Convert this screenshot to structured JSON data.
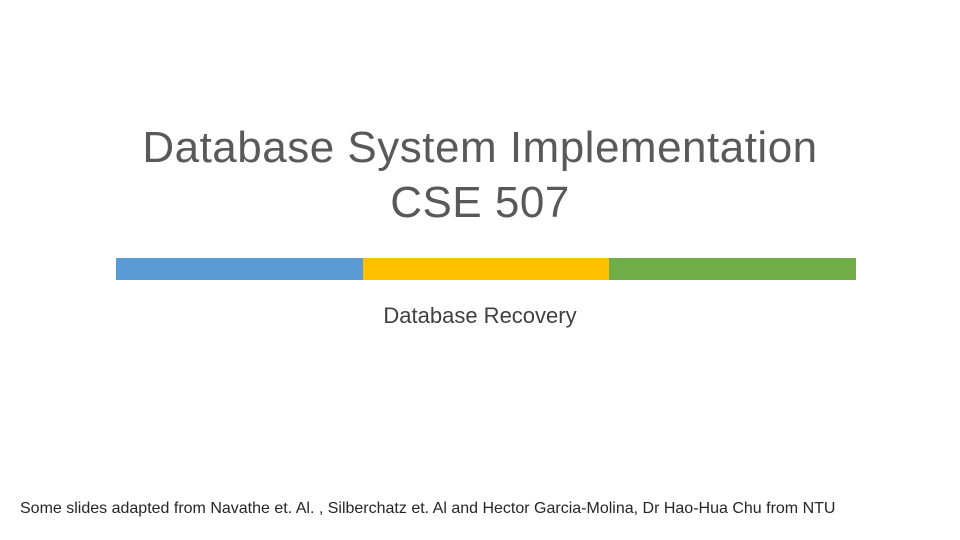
{
  "title": {
    "line1": "Database System Implementation",
    "line2": "CSE 507"
  },
  "subtitle": "Database Recovery",
  "footer": "Some slides adapted from Navathe et. Al. ,  Silberchatz et. Al and Hector Garcia-Molina, Dr Hao-Hua Chu from NTU",
  "bar_colors": {
    "blue": "#5B9BD5",
    "yellow": "#FFC000",
    "green": "#70AD47"
  }
}
